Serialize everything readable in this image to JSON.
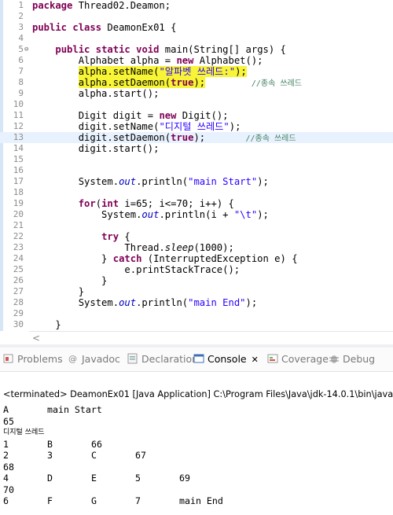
{
  "editor": {
    "lines": [
      {
        "n": "1",
        "parts": [
          [
            "kw",
            "package"
          ],
          [
            "t",
            " Thread02.Deamon;"
          ]
        ]
      },
      {
        "n": "2",
        "parts": []
      },
      {
        "n": "3",
        "parts": [
          [
            "kw",
            "public"
          ],
          [
            "t",
            " "
          ],
          [
            "kw",
            "class"
          ],
          [
            "t",
            " DeamonEx01 {"
          ]
        ]
      },
      {
        "n": "4",
        "parts": []
      },
      {
        "n": "5",
        "fold": "⊖",
        "parts": [
          [
            "t",
            "    "
          ],
          [
            "kw",
            "public"
          ],
          [
            "t",
            " "
          ],
          [
            "kw",
            "static"
          ],
          [
            "t",
            " "
          ],
          [
            "kw",
            "void"
          ],
          [
            "t",
            " main(String[] args) {"
          ]
        ]
      },
      {
        "n": "6",
        "parts": [
          [
            "t",
            "        Alphabet alpha = "
          ],
          [
            "kw",
            "new"
          ],
          [
            "t",
            " Alphabet();"
          ]
        ]
      },
      {
        "n": "7",
        "parts": [
          [
            "t",
            "        "
          ],
          [
            "y",
            "alpha.setName("
          ],
          [
            "ys",
            "\"알파벳 쓰레드:\""
          ],
          [
            "y",
            ");"
          ]
        ]
      },
      {
        "n": "8",
        "parts": [
          [
            "t",
            "        "
          ],
          [
            "y",
            "alpha.setDaemon("
          ],
          [
            "yk",
            "true"
          ],
          [
            "y",
            ");"
          ],
          [
            "t",
            "        "
          ],
          [
            "cm",
            "//종속 쓰레드"
          ]
        ]
      },
      {
        "n": "9",
        "parts": [
          [
            "t",
            "        alpha.start();"
          ]
        ]
      },
      {
        "n": "10",
        "parts": []
      },
      {
        "n": "11",
        "parts": [
          [
            "t",
            "        Digit digit = "
          ],
          [
            "kw",
            "new"
          ],
          [
            "t",
            " Digit();"
          ]
        ]
      },
      {
        "n": "12",
        "parts": [
          [
            "t",
            "        digit.setName("
          ],
          [
            "str",
            "\"디지털 쓰레드\""
          ],
          [
            "t",
            ");"
          ]
        ]
      },
      {
        "n": "13",
        "hl": true,
        "parts": [
          [
            "t",
            "        digit.setDaemon("
          ],
          [
            "kw",
            "true"
          ],
          [
            "t",
            ");       "
          ],
          [
            "cm",
            "//종속 쓰레드"
          ]
        ]
      },
      {
        "n": "14",
        "parts": [
          [
            "t",
            "        digit.start();"
          ]
        ]
      },
      {
        "n": "15",
        "parts": []
      },
      {
        "n": "16",
        "parts": []
      },
      {
        "n": "17",
        "parts": [
          [
            "t",
            "        System."
          ],
          [
            "fld",
            "out"
          ],
          [
            "t",
            ".println("
          ],
          [
            "str",
            "\"main Start\""
          ],
          [
            "t",
            ");"
          ]
        ]
      },
      {
        "n": "18",
        "parts": []
      },
      {
        "n": "19",
        "parts": [
          [
            "t",
            "        "
          ],
          [
            "kw",
            "for"
          ],
          [
            "t",
            "("
          ],
          [
            "kw",
            "int"
          ],
          [
            "t",
            " i=65; i<=70; i++) {"
          ]
        ]
      },
      {
        "n": "20",
        "parts": [
          [
            "t",
            "            System."
          ],
          [
            "fld",
            "out"
          ],
          [
            "t",
            ".println(i + "
          ],
          [
            "str",
            "\"\\t\""
          ],
          [
            "t",
            ");"
          ]
        ]
      },
      {
        "n": "21",
        "parts": []
      },
      {
        "n": "22",
        "parts": [
          [
            "t",
            "            "
          ],
          [
            "kw",
            "try"
          ],
          [
            "t",
            " {"
          ]
        ]
      },
      {
        "n": "23",
        "parts": [
          [
            "t",
            "                Thread."
          ],
          [
            "it",
            "sleep"
          ],
          [
            "t",
            "(1000);"
          ]
        ]
      },
      {
        "n": "24",
        "parts": [
          [
            "t",
            "            } "
          ],
          [
            "kw",
            "catch"
          ],
          [
            "t",
            " (InterruptedException e) {"
          ]
        ]
      },
      {
        "n": "25",
        "parts": [
          [
            "t",
            "                e.printStackTrace();"
          ]
        ]
      },
      {
        "n": "26",
        "parts": [
          [
            "t",
            "            }"
          ]
        ]
      },
      {
        "n": "27",
        "parts": [
          [
            "t",
            "        }"
          ]
        ]
      },
      {
        "n": "28",
        "parts": [
          [
            "t",
            "        System."
          ],
          [
            "fld",
            "out"
          ],
          [
            "t",
            ".println("
          ],
          [
            "str",
            "\"main End\""
          ],
          [
            "t",
            ");"
          ]
        ]
      },
      {
        "n": "29",
        "parts": []
      },
      {
        "n": "30",
        "parts": [
          [
            "t",
            "    }"
          ]
        ]
      }
    ]
  },
  "tabs": [
    {
      "label": "Problems",
      "icon": "problems-icon",
      "active": false
    },
    {
      "label": "Javadoc",
      "icon": "javadoc-icon",
      "active": false
    },
    {
      "label": "Declaration",
      "icon": "declaration-icon",
      "active": false
    },
    {
      "label": "Console",
      "icon": "console-icon",
      "active": true,
      "close": "✕"
    },
    {
      "label": "Coverage",
      "icon": "coverage-icon",
      "active": false
    },
    {
      "label": "Debug",
      "icon": "debug-icon",
      "active": false
    }
  ],
  "console": {
    "terminated": "<terminated> DeamonEx01 [Java Application] C:\\Program Files\\Java\\jdk-14.0.1\\bin\\java",
    "rows": [
      [
        "A",
        "main Start"
      ],
      [
        "65"
      ],
      [
        "디지털 쓰레드"
      ],
      [
        "1",
        "B",
        "66"
      ],
      [
        "2",
        "3",
        "C",
        "67"
      ],
      [
        "68"
      ],
      [
        "4",
        "D",
        "E",
        "5",
        "69"
      ],
      [
        "70"
      ],
      [
        "6",
        "F",
        "G",
        "7",
        "main End"
      ]
    ]
  },
  "colors": {
    "keyword": "#7f0055",
    "string": "#2a00ff",
    "comment": "#3f7f5f",
    "highlight_yellow": "#f7f536",
    "current_line": "#e8f2fe"
  }
}
